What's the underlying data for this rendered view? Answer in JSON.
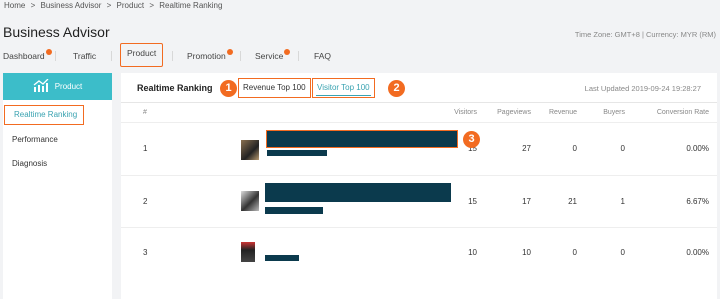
{
  "breadcrumb": [
    "Home",
    ">",
    "Business Advisor",
    ">",
    "Product",
    ">",
    "Realtime Ranking"
  ],
  "app_title": "Business Advisor",
  "timezone_info": "Time Zone: GMT+8 | Currency: MYR (RM)",
  "nav": {
    "dashboard": "Dashboard",
    "traffic": "Traffic",
    "product": "Product",
    "promotion": "Promotion",
    "service": "Service",
    "faq": "FAQ"
  },
  "sidebar": {
    "header": "Product",
    "items": [
      "Realtime Ranking",
      "Performance",
      "Diagnosis"
    ]
  },
  "main": {
    "title": "Realtime Ranking",
    "tab_revenue": "Revenue Top 100",
    "tab_visitor": "Visitor Top 100",
    "last_updated": "Last Updated 2019-09-24 19:28:27",
    "badges": [
      "1",
      "2",
      "3"
    ],
    "columns": [
      "#",
      "Visitors",
      "Pageviews",
      "Revenue",
      "Buyers",
      "Conversion Rate"
    ],
    "rows": [
      {
        "rank": "1",
        "visitors": "15",
        "pageviews": "27",
        "revenue": "0",
        "buyers": "0",
        "conversion": "0.00%"
      },
      {
        "rank": "2",
        "visitors": "15",
        "pageviews": "17",
        "revenue": "21",
        "buyers": "1",
        "conversion": "6.67%"
      },
      {
        "rank": "3",
        "visitors": "10",
        "pageviews": "10",
        "revenue": "0",
        "buyers": "0",
        "conversion": "0.00%"
      }
    ]
  },
  "colors": {
    "accent": "#f26b21",
    "teal": "#3cbdc9",
    "redaction": "#0b3a4d"
  }
}
